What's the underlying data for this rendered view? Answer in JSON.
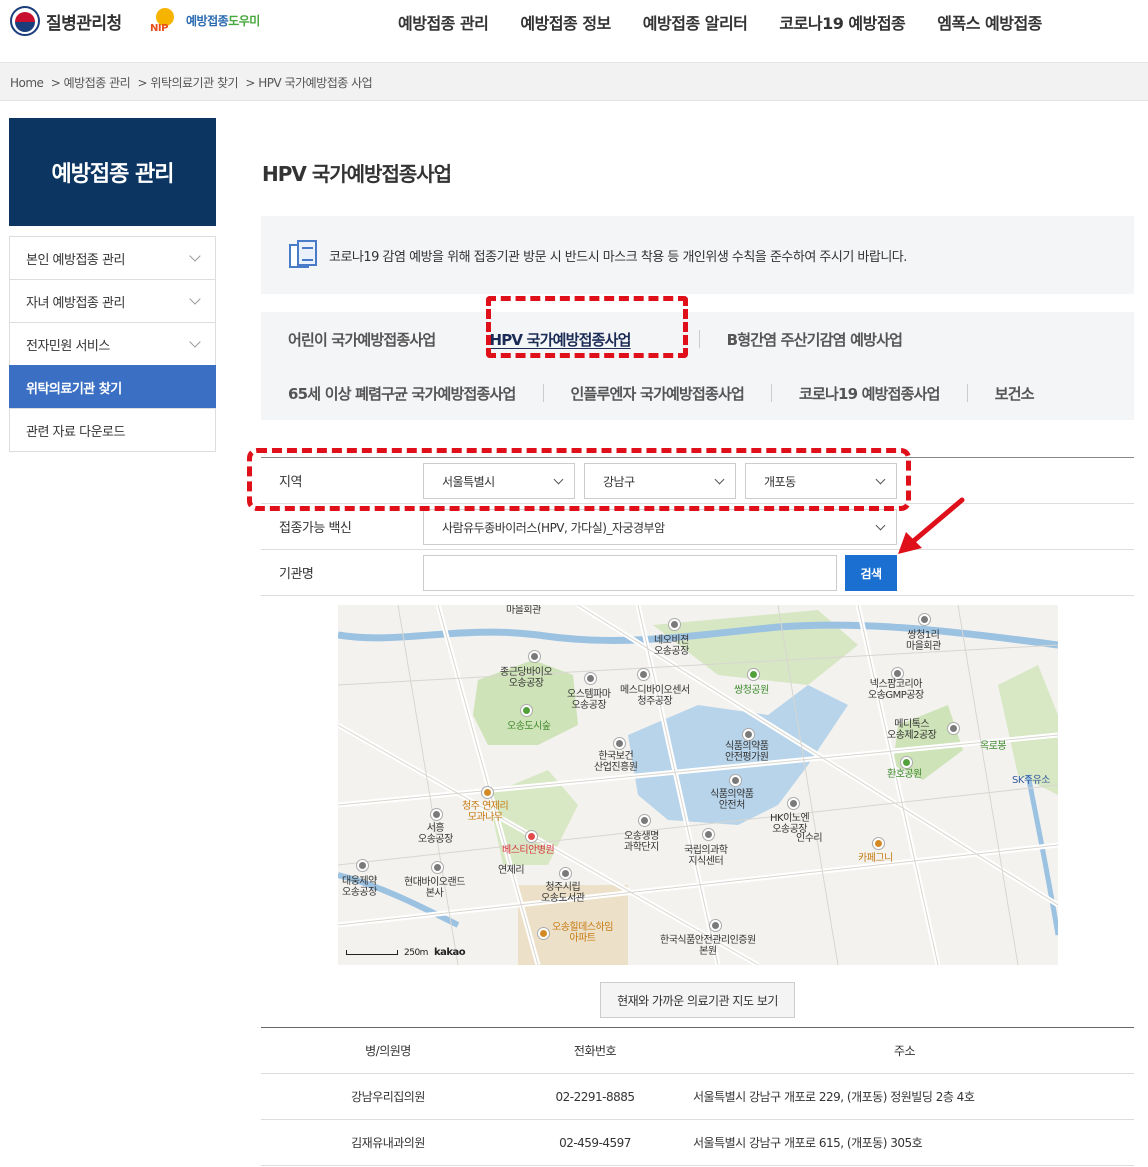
{
  "header": {
    "agency": "질병관리청",
    "helper_brand": "예방접종도우미",
    "helper_brand_a": "예방접종",
    "helper_brand_b": "도우미",
    "nip": "NIP",
    "gnb": [
      "예방접종 관리",
      "예방접종 정보",
      "예방접종 알리터",
      "코로나19 예방접종",
      "엠폭스 예방접종"
    ]
  },
  "breadcrumb": [
    "Home",
    "> 예방접종 관리",
    "> 위탁의료기관 찾기",
    "> HPV 국가예방접종 사업"
  ],
  "lnb": {
    "title": "예방접종 관리",
    "items": [
      {
        "label": "본인 예방접종 관리",
        "active": false,
        "chevron": true
      },
      {
        "label": "자녀 예방접종 관리",
        "active": false,
        "chevron": true
      },
      {
        "label": "전자민원 서비스",
        "active": false,
        "chevron": true
      },
      {
        "label": "위탁의료기관 찾기",
        "active": true,
        "chevron": false
      },
      {
        "label": "관련 자료 다운로드",
        "active": false,
        "chevron": false
      }
    ]
  },
  "main": {
    "title": "HPV 국가예방접종사업",
    "notice": "코로나19 감염 예방을 위해 접종기관 방문 시 반드시 마스크 착용 등 개인위생 수칙을 준수하여 주시기 바랍니다.",
    "tabs_row1": [
      "어린이 국가예방접종사업",
      "HPV 국가예방접종사업",
      "B형간염 주산기감염 예방사업"
    ],
    "tabs_row2": [
      "65세 이상 폐렴구균 국가예방접종사업",
      "인플루엔자 국가예방접종사업",
      "코로나19 예방접종사업",
      "보건소"
    ],
    "active_tab": "HPV 국가예방접종사업"
  },
  "form": {
    "region_label": "지역",
    "sido": "서울특별시",
    "sigungu": "강남구",
    "dong": "개포동",
    "vaccine_label": "접종가능 백신",
    "vaccine": "사람유두종바이러스(HPV, 가다실)_자궁경부암",
    "org_label": "기관명",
    "org_value": "",
    "search_button": "검색"
  },
  "map": {
    "labels": {
      "l1": "마을회관",
      "l2": "네오비젼\n오송공장",
      "l3": "쌍청1리\n마을회관",
      "l4": "종근당바이오\n오송공장",
      "l5": "오스템파마\n오송공장",
      "l6": "메스디바이오센서\n청주공장",
      "l7": "쌍청공원",
      "l8": "넥스팜코리아\n오송GMP공장",
      "l9": "오송도시숲",
      "l10": "메디톡스\n오송제2공장",
      "l11": "옥로봉",
      "l12": "한국보건\n산업진흥원",
      "l13": "식품의약품\n안전평가원",
      "l14": "환호공원",
      "l15": "SK주유소",
      "l16": "식품의약품\n안전처",
      "l17": "청주 연제리\n모과나무",
      "l18": "HK이노엔\n오송공장",
      "l19": "인수리",
      "l20": "서흥\n오송공장",
      "l21": "오송생명\n과학단지",
      "l22": "베스티안병원",
      "l23": "국립의과학\n지식센터",
      "l24": "카페그니",
      "l25": "연제리",
      "l26": "대웅제약\n오송공장",
      "l27": "현대바이오랜드\n본사",
      "l28": "청주시립\n오송도서관",
      "l29": "오송힐데스하임\n아파트",
      "l30": "한국식품안전관리인증원\n본원"
    },
    "scale": "250m",
    "brand": "kakao"
  },
  "nearby_button": "현재와 가까운 의료기관 지도 보기",
  "table": {
    "headers": [
      "병/의원명",
      "전화번호",
      "주소"
    ],
    "rows": [
      [
        "강남우리집의원",
        "02-2291-8885",
        "서울특별시 강남구 개포로 229, (개포동) 정원빌딩 2층 4호"
      ],
      [
        "김재유내과의원",
        "02-459-4597",
        "서울특별시 강남구 개포로 615, (개포동) 305호"
      ]
    ]
  },
  "colors": {
    "lnb_title_bg": "#0c3561",
    "lnb_active_bg": "#3a6fc4",
    "search_btn": "#1b6fd1",
    "highlight": "#e0101b"
  }
}
